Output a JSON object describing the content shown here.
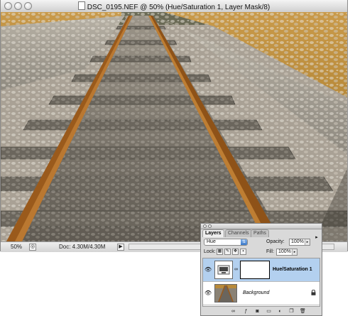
{
  "window": {
    "title": "DSC_0195.NEF @ 50% (Hue/Saturation 1, Layer Mask/8)"
  },
  "statusbar": {
    "zoom": "50%",
    "doc_info": "Doc: 4.30M/4.30M"
  },
  "layers_panel": {
    "tabs": [
      {
        "label": "Layers",
        "active": true
      },
      {
        "label": "Channels",
        "active": false
      },
      {
        "label": "Paths",
        "active": false
      }
    ],
    "blend_mode": "Hue",
    "opacity_label": "Opacity:",
    "opacity_value": "100%",
    "lock_label": "Lock:",
    "fill_label": "Fill:",
    "fill_value": "100%",
    "layers": [
      {
        "name": "Hue/Saturation 1",
        "selected": true,
        "visible": true,
        "type": "adjustment"
      },
      {
        "name": "Background",
        "selected": false,
        "visible": true,
        "locked": true,
        "type": "image"
      }
    ],
    "footer_icons": [
      "link-icon",
      "layer-style-icon",
      "add-mask-icon",
      "new-group-icon",
      "new-adjustment-icon",
      "new-layer-icon",
      "trash-icon"
    ]
  },
  "colors": {
    "selection_blue": "#b3d0ef",
    "panel_gray": "#d9d9d9",
    "rust": "#9a5a1c",
    "grass_orange": "#d99a3a"
  }
}
